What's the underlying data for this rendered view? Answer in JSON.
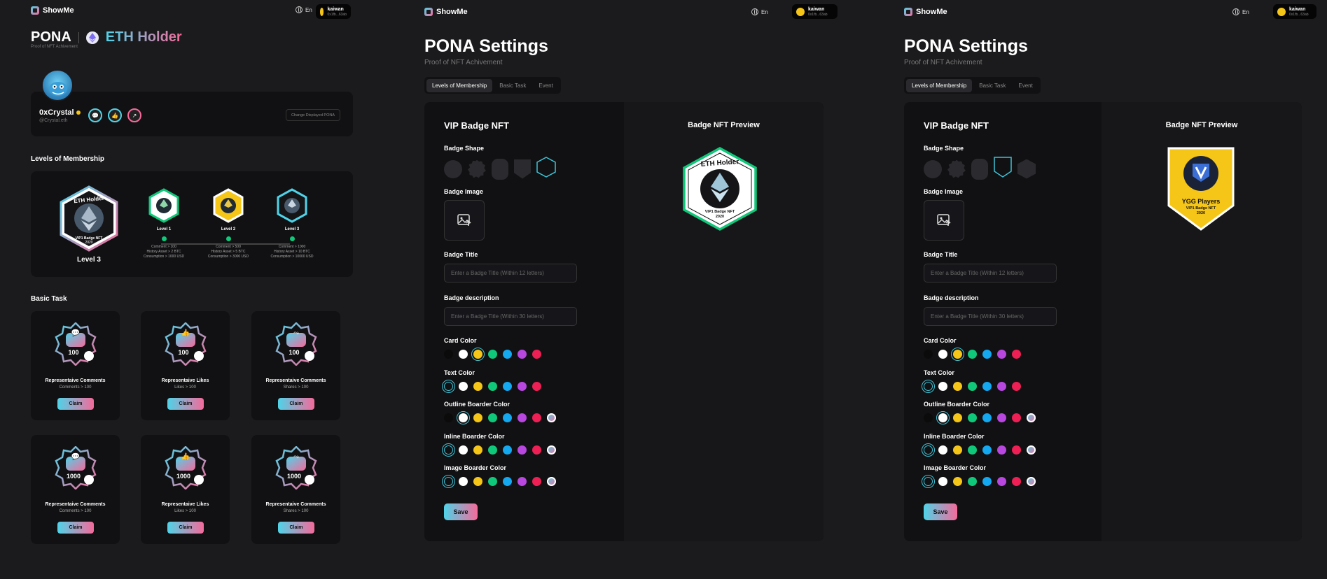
{
  "brand": "ShowMe",
  "lang": "En",
  "wallet": {
    "name": "kaiwan",
    "addr": "0x1fb...63ab"
  },
  "profile_page": {
    "title": "PONA",
    "badge_title": "ETH Holder",
    "subtitle": "Proof of NFT Achivement",
    "username": "0xCrystal",
    "handle": "@Crystal.eth",
    "change_button": "Change Displayed PONA",
    "membership_heading": "Levels of Membership",
    "current_level": "Level 3",
    "badge_name": "ETH Holder",
    "badge_sub": "VIP1 Badge NFT",
    "badge_year": "2020",
    "levels": [
      {
        "name": "Level 1",
        "req": [
          "Comment > 100",
          "History Asset > 2 BTC",
          "Consumption > 1000 USD"
        ]
      },
      {
        "name": "Level 2",
        "req": [
          "Comment > 500",
          "History Asset > 5 BTC",
          "Consumption > 3000 USD"
        ]
      },
      {
        "name": "Level 3",
        "req": [
          "Comment > 1000",
          "History Asset > 10 BTC",
          "Consumption > 10000 USD"
        ]
      }
    ],
    "task_heading": "Basic Task",
    "tasks": [
      {
        "title": "Representaive Comments",
        "req": "Comments > 100",
        "num": "100",
        "claim": "Claim"
      },
      {
        "title": "Representaive Likes",
        "req": "Likes > 100",
        "num": "100",
        "claim": "Claim"
      },
      {
        "title": "Representaive Comments",
        "req": "Shares > 100",
        "num": "100",
        "claim": "Claim"
      },
      {
        "title": "Representaive Comments",
        "req": "Comments > 100",
        "num": "1000",
        "claim": "Claim"
      },
      {
        "title": "Representaive Likes",
        "req": "Likes > 100",
        "num": "1000",
        "claim": "Claim"
      },
      {
        "title": "Representaive Comments",
        "req": "Shares > 100",
        "num": "1000",
        "claim": "Claim"
      }
    ]
  },
  "settings": {
    "title": "PONA Settings",
    "subtitle": "Proof of NFT Achivement",
    "tabs": [
      "Levels of Membership",
      "Basic Task",
      "Event"
    ],
    "form_title": "VIP Badge NFT",
    "shape_label": "Badge Shape",
    "image_label": "Badge Image",
    "title_label": "Badge Title",
    "title_placeholder": "Enter a Badge Title (Within 12 letters)",
    "desc_label": "Badge description",
    "desc_placeholder": "Enter a Badge Title (Within 30 letters)",
    "color_labels": [
      "Card Color",
      "Text Color",
      "Outline Boarder Color",
      "Inline Boarder Color",
      "Image Boarder Color"
    ],
    "save": "Save",
    "preview_title": "Badge NFT Preview"
  },
  "preview_a": {
    "name": "ETH Holder",
    "sub": "VIP1 Badge NFT",
    "year": "2020"
  },
  "preview_b": {
    "name": "YGG Players",
    "sub": "VIP1 Badge NFT",
    "year": "2020"
  },
  "palette": [
    "#0b0b0c",
    "#ffffff",
    "#f5c518",
    "#10c87a",
    "#13a8f0",
    "#b847e0",
    "#ee1f54"
  ],
  "colors": {
    "accent": "#3fc3d6",
    "pink": "#f56a9a",
    "bg": "#1b1b1e"
  }
}
